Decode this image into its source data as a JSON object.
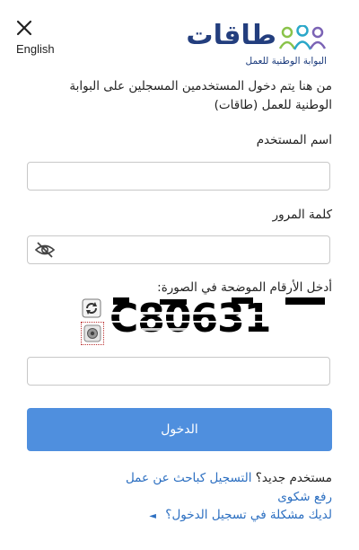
{
  "header": {
    "close_label": "",
    "language_label": "English",
    "logo": {
      "title": "طاقات",
      "subtitle": "البوابة الوطنية للعمل",
      "colors": [
        "#8ac34a",
        "#2aa7c9",
        "#7b63b5",
        "#233e7e"
      ]
    }
  },
  "intro_text": "من هنا يتم دخول المستخدمين المسجلين على البوابة الوطنية للعمل (طاقات)",
  "form": {
    "username_label": "اسم المستخدم",
    "username_value": "",
    "password_label": "كلمة المرور",
    "password_value": "",
    "captcha_label": "أدخل الأرقام الموضحة في الصورة:",
    "captcha_code": "C80631",
    "captcha_value": "",
    "login_label": "الدخول",
    "login_color": "#4f8fde"
  },
  "links": {
    "new_user_prefix": "مستخدم جديد؟",
    "register_jobseeker": "التسجيل كباحث عن عمل",
    "complaint": "رفع شكوى",
    "login_problem": "لديك مشكلة في تسجيل الدخول؟",
    "link_color": "#2c6fc1"
  },
  "icons": {
    "close": "close-icon",
    "eye": "eye-slash-icon",
    "refresh": "refresh-icon",
    "audio": "audio-icon",
    "arrow": "triangle-left-icon"
  }
}
